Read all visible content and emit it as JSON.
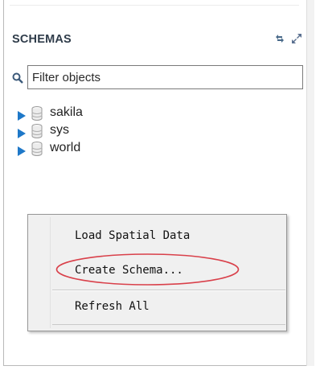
{
  "panel": {
    "title": "SCHEMAS",
    "header_icons": [
      "refresh-icon",
      "expand-icon"
    ]
  },
  "search": {
    "placeholder": "Filter objects",
    "icon": "search-icon"
  },
  "schemas": [
    {
      "label": "sakila",
      "icon": "database-icon"
    },
    {
      "label": "sys",
      "icon": "database-icon"
    },
    {
      "label": "world",
      "icon": "database-icon"
    }
  ],
  "context_menu": {
    "items": [
      "Load Spatial Data",
      "Create Schema...",
      "Refresh All"
    ],
    "highlighted": "Create Schema...",
    "highlight_color": "#d9404a"
  },
  "colors": {
    "title": "#2f3c4a",
    "arrow": "#1e78c8",
    "menu_bg": "#f0f0f0"
  }
}
